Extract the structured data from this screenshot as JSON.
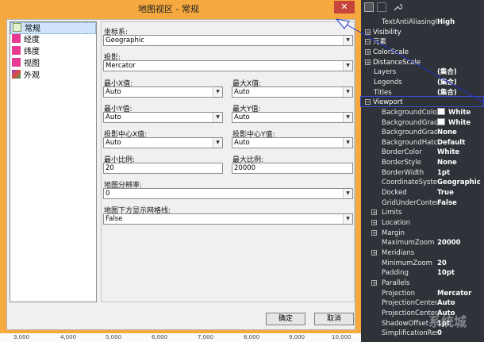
{
  "dialog": {
    "title": "地图视区 - 常规",
    "close_label": "✕",
    "nav": [
      "常规",
      "经度",
      "纬度",
      "视图",
      "外观"
    ],
    "form": {
      "coord_label": "坐标系:",
      "coord_value": "Geographic",
      "proj_label": "投影:",
      "proj_value": "Mercator",
      "minx_label": "最小X值:",
      "minx_value": "Auto",
      "maxx_label": "最大X值:",
      "maxx_value": "Auto",
      "miny_label": "最小Y值:",
      "miny_value": "Auto",
      "maxy_label": "最大Y值:",
      "maxy_value": "Auto",
      "pcx_label": "投影中心X值:",
      "pcx_value": "Auto",
      "pcy_label": "投影中心Y值:",
      "pcy_value": "Auto",
      "minscale_label": "最小比例:",
      "minscale_value": "20",
      "maxscale_label": "最大比例:",
      "maxscale_value": "20000",
      "res_label": "地图分辨率:",
      "res_value": "0",
      "grid_label": "地图下方显示网格线:",
      "grid_value": "False"
    },
    "ok_label": "确定",
    "cancel_label": "取消",
    "axis_ticks": [
      "3,000",
      "4,000",
      "5,000",
      "6,000",
      "7,000",
      "8,000",
      "9,000",
      "10,000"
    ]
  },
  "panel": {
    "rows": [
      {
        "name": "TextAntiAliasingQua",
        "value": "High",
        "kind": "indent"
      },
      {
        "name": "Visibility",
        "value": "",
        "kind": "cat",
        "pm": "+"
      },
      {
        "name": "元素",
        "value": "",
        "kind": "cat",
        "pm": "−"
      },
      {
        "name": "ColorScale",
        "value": "",
        "kind": "cat",
        "pm": "+"
      },
      {
        "name": "DistanceScale",
        "value": "",
        "kind": "cat",
        "pm": "+"
      },
      {
        "name": "Layers",
        "value": "(集合)",
        "kind": "top"
      },
      {
        "name": "Legends",
        "value": "(集合)",
        "kind": "top"
      },
      {
        "name": "Titles",
        "value": "(集合)",
        "kind": "top"
      },
      {
        "name": "Viewport",
        "value": "",
        "kind": "cat",
        "pm": "−"
      },
      {
        "name": "BackgroundColo",
        "value": "White",
        "kind": "indent",
        "swatch": true
      },
      {
        "name": "BackgroundGrad",
        "value": "White",
        "kind": "indent",
        "swatch": true
      },
      {
        "name": "BackgroundGrad",
        "value": "None",
        "kind": "indent"
      },
      {
        "name": "BackgroundHatch",
        "value": "Default",
        "kind": "indent"
      },
      {
        "name": "BorderColor",
        "value": "White",
        "kind": "indent"
      },
      {
        "name": "BorderStyle",
        "value": "None",
        "kind": "indent"
      },
      {
        "name": "BorderWidth",
        "value": "1pt",
        "kind": "indent"
      },
      {
        "name": "CoordinateSysten",
        "value": "Geographic",
        "kind": "indent"
      },
      {
        "name": "Docked",
        "value": "True",
        "kind": "indent"
      },
      {
        "name": "GridUnderConten",
        "value": "False",
        "kind": "indent"
      },
      {
        "name": "Limits",
        "value": "",
        "kind": "sub",
        "pm": "+"
      },
      {
        "name": "Location",
        "value": "",
        "kind": "sub",
        "pm": "+"
      },
      {
        "name": "Margin",
        "value": "",
        "kind": "sub",
        "pm": "+"
      },
      {
        "name": "MaximumZoom",
        "value": "20000",
        "kind": "indent"
      },
      {
        "name": "Meridians",
        "value": "",
        "kind": "sub",
        "pm": "+"
      },
      {
        "name": "MinimumZoom",
        "value": "20",
        "kind": "indent"
      },
      {
        "name": "Padding",
        "value": "10pt",
        "kind": "indent"
      },
      {
        "name": "Parallels",
        "value": "",
        "kind": "sub",
        "pm": "+"
      },
      {
        "name": "Projection",
        "value": "Mercator",
        "kind": "indent"
      },
      {
        "name": "ProjectionCenterX",
        "value": "Auto",
        "kind": "indent"
      },
      {
        "name": "ProjectionCenterY",
        "value": "Auto",
        "kind": "indent"
      },
      {
        "name": "ShadowOffset",
        "value": "1pt",
        "kind": "indent"
      },
      {
        "name": "SimplificationRes",
        "value": "0",
        "kind": "indent"
      }
    ]
  },
  "watermark": "系统城"
}
